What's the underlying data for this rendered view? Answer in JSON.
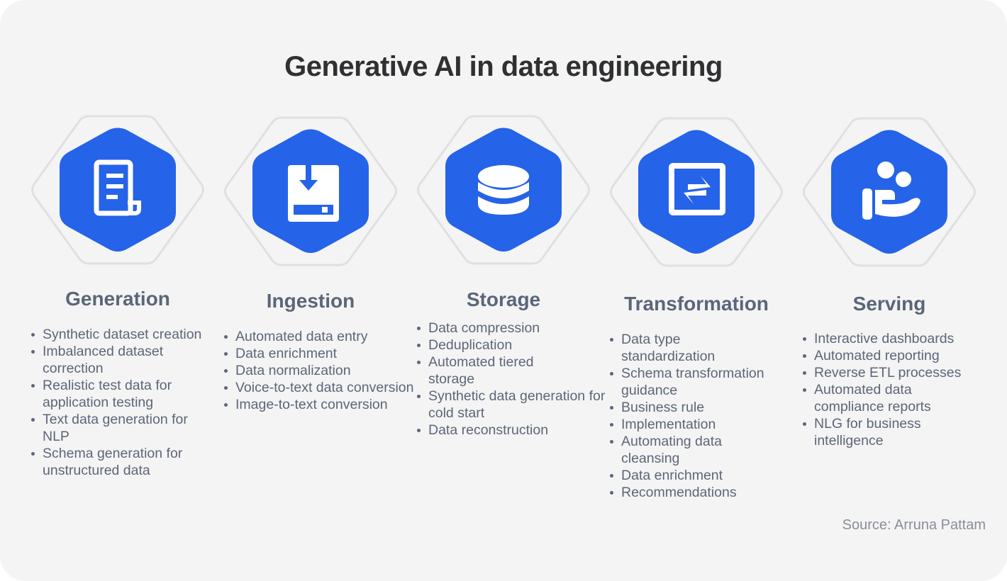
{
  "title": "Generative AI in data engineering",
  "accent_color": "#2563e8",
  "stages": [
    {
      "name": "Generation",
      "icon": "document-icon",
      "items": [
        "Synthetic dataset creation",
        "Imbalanced dataset correction",
        "Realistic test data for application testing",
        "Text data generation for NLP",
        "Schema generation for unstructured data"
      ]
    },
    {
      "name": "Ingestion",
      "icon": "download-inbox-icon",
      "items": [
        "Automated data entry",
        "Data enrichment",
        "Data normalization",
        "Voice-to-text data conversion",
        "Image-to-text conversion"
      ]
    },
    {
      "name": "Storage",
      "icon": "database-icon",
      "items": [
        "Data compression",
        "Deduplication",
        "Automated tiered storage",
        "Synthetic data generation for cold start",
        "Data reconstruction"
      ]
    },
    {
      "name": "Transformation",
      "icon": "transform-arrows-icon",
      "items": [
        "Data type standardization",
        "Schema transformation guidance",
        "Business rule",
        "Implementation",
        "Automating data cleansing",
        "Data enrichment",
        "Recommendations"
      ]
    },
    {
      "name": "Serving",
      "icon": "serving-hand-people-icon",
      "items": [
        "Interactive dashboards",
        "Automated reporting",
        "Reverse ETL processes",
        "Automated data compliance reports",
        "NLG for business intelligence"
      ]
    }
  ],
  "source": "Source: Arruna Pattam"
}
